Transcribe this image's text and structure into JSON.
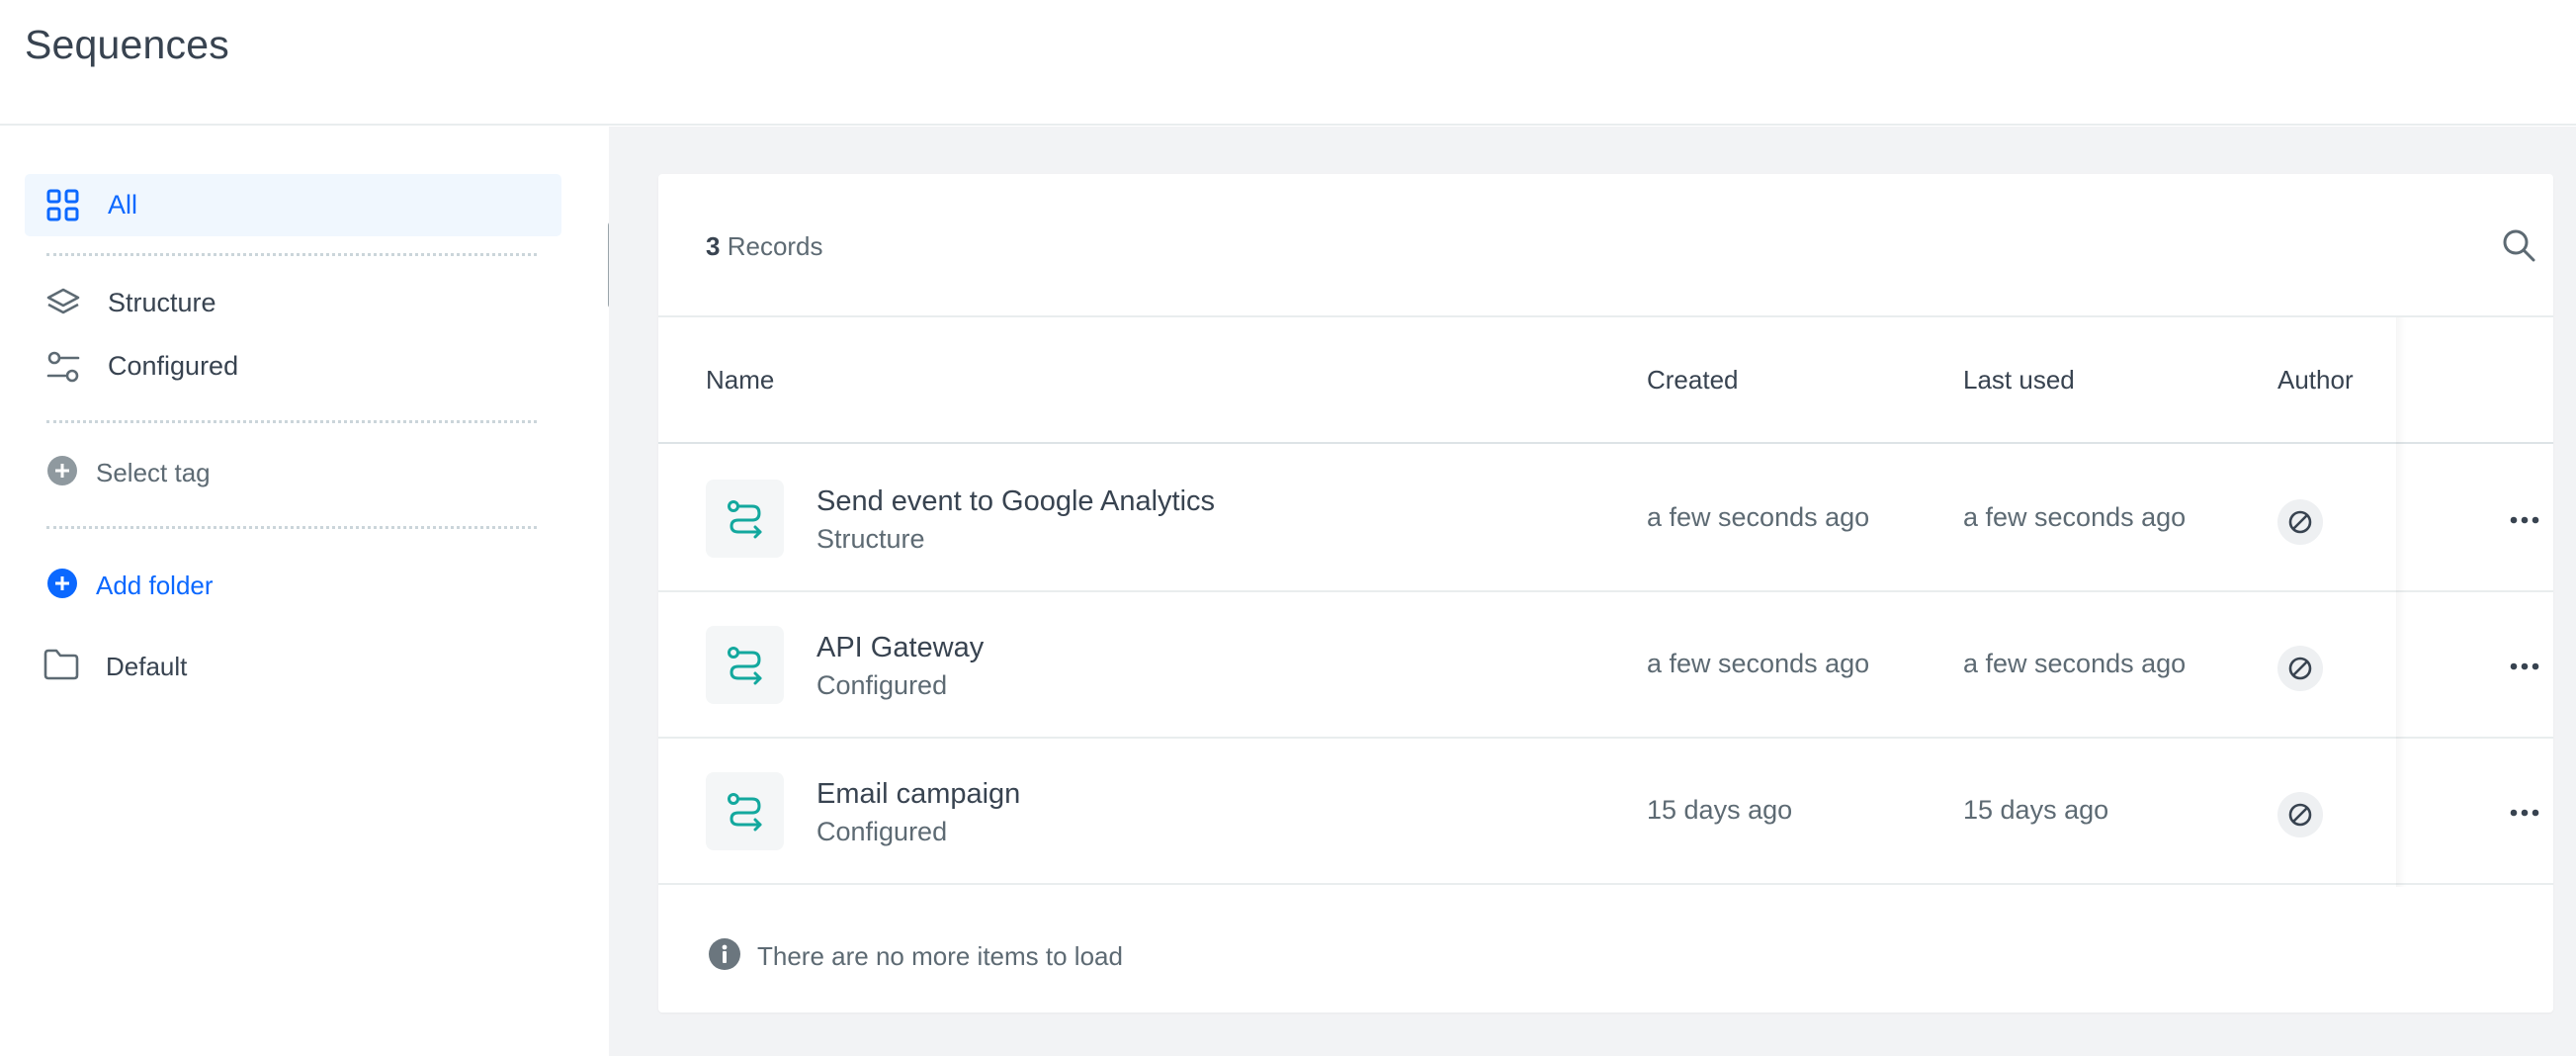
{
  "header": {
    "title": "Sequences"
  },
  "sidebar": {
    "nav": [
      {
        "label": "All",
        "icon": "grid-icon",
        "active": true
      },
      {
        "label": "Structure",
        "icon": "layers-icon"
      },
      {
        "label": "Configured",
        "icon": "sliders-icon"
      }
    ],
    "select_tag": "Select tag",
    "add_folder": "Add folder",
    "folders": [
      {
        "label": "Default",
        "icon": "folder-icon"
      }
    ]
  },
  "main": {
    "records": {
      "count": "3",
      "label": "Records"
    },
    "columns": {
      "name": "Name",
      "created": "Created",
      "last_used": "Last used",
      "author": "Author"
    },
    "rows": [
      {
        "name": "Send event to Google Analytics",
        "type": "Structure",
        "created": "a few seconds ago",
        "last_used": "a few seconds ago"
      },
      {
        "name": "API Gateway",
        "type": "Configured",
        "created": "a few seconds ago",
        "last_used": "a few seconds ago"
      },
      {
        "name": "Email campaign",
        "type": "Configured",
        "created": "15 days ago",
        "last_used": "15 days ago"
      }
    ],
    "footer_note": "There are no more items to load"
  },
  "colors": {
    "accent": "#0b68ff",
    "text": "#384350",
    "muted": "#5d6a73",
    "teal_icon": "#13a89e",
    "active_bg": "#f0f7fe"
  }
}
